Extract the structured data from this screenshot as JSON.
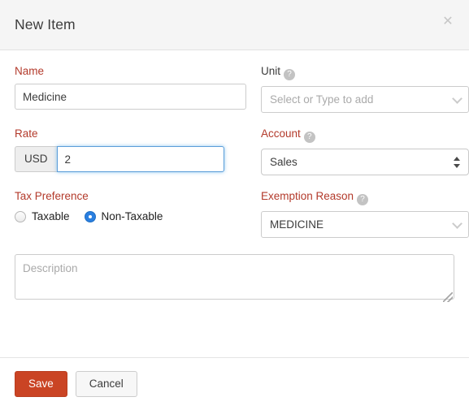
{
  "dialog": {
    "title": "New Item",
    "close_icon": "close-icon"
  },
  "form": {
    "name": {
      "label": "Name",
      "value": "Medicine",
      "required": true
    },
    "unit": {
      "label": "Unit",
      "placeholder": "Select or Type to add",
      "value": "",
      "help_icon": "help-circle-icon",
      "required": false
    },
    "rate": {
      "label": "Rate",
      "currency": "USD",
      "value": "2",
      "required": true,
      "focused": true
    },
    "account": {
      "label": "Account",
      "value": "Sales",
      "help_icon": "help-circle-icon",
      "required": true
    },
    "tax_preference": {
      "label": "Tax Preference",
      "required": true,
      "options": [
        {
          "label": "Taxable",
          "selected": false
        },
        {
          "label": "Non-Taxable",
          "selected": true
        }
      ]
    },
    "exemption_reason": {
      "label": "Exemption Reason",
      "value": "MEDICINE",
      "help_icon": "help-circle-icon",
      "required": true
    },
    "description": {
      "placeholder": "Description",
      "value": ""
    }
  },
  "footer": {
    "save_label": "Save",
    "cancel_label": "Cancel"
  },
  "colors": {
    "required_label": "#b33a2b",
    "primary_button": "#ca4424",
    "radio_selected": "#2a7fe0",
    "focus_border": "#5b9dd9",
    "header_bg": "#f5f5f5"
  }
}
